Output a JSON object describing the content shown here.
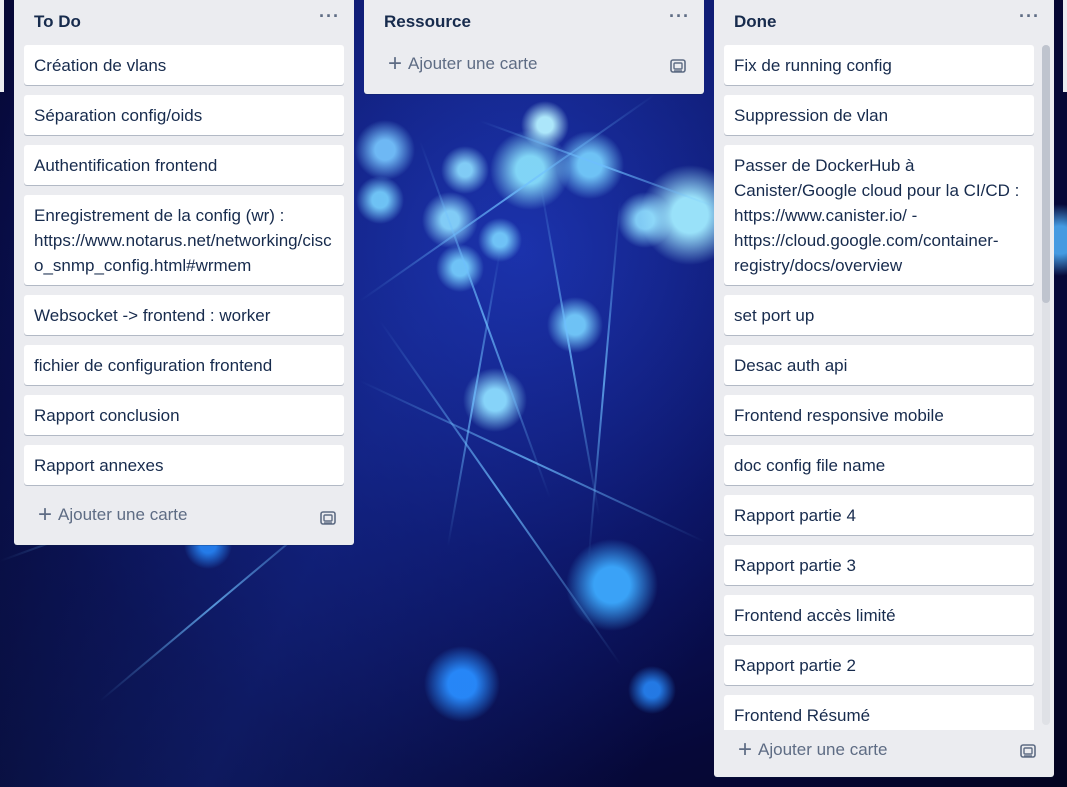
{
  "lists": [
    {
      "title": "To Do",
      "cards": [
        "Création de vlans",
        "Séparation config/oids",
        "Authentification frontend",
        "Enregistrement de la config (wr) : https://www.notarus.net/networking/cisco_snmp_config.html#wrmem",
        "Websocket -> frontend : worker",
        "fichier de configuration frontend",
        "Rapport conclusion",
        "Rapport annexes"
      ],
      "add_card_label": "Ajouter une carte",
      "menu_label": "···"
    },
    {
      "title": "Ressource",
      "cards": [],
      "add_card_label": "Ajouter une carte",
      "menu_label": "···"
    },
    {
      "title": "Done",
      "cards": [
        "Fix de running config",
        "Suppression de vlan",
        "Passer de DockerHub à Canister/Google cloud pour la CI/CD : https://www.canister.io/ - https://cloud.google.com/container-registry/docs/overview",
        "set port up",
        "Desac auth api",
        "Frontend responsive mobile",
        "doc config file name",
        "Rapport partie 4",
        "Rapport partie 3",
        "Frontend accès limité",
        "Rapport partie 2",
        "Frontend Résumé"
      ],
      "add_card_label": "Ajouter une carte",
      "menu_label": "···"
    }
  ],
  "icons": {
    "plus": "+",
    "menu": "ellipsis-icon",
    "template": "card-template-icon"
  }
}
